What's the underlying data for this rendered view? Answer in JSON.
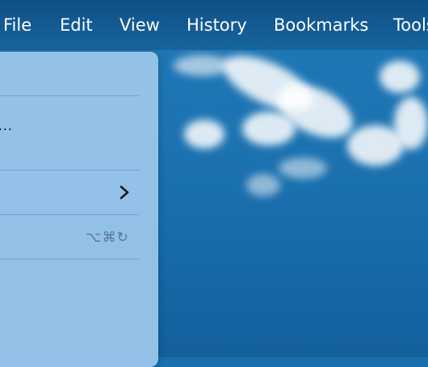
{
  "menubar": {
    "items": [
      {
        "label": "File"
      },
      {
        "label": "Edit"
      },
      {
        "label": "View"
      },
      {
        "label": "History"
      },
      {
        "label": "Bookmarks"
      },
      {
        "label": "Tools"
      }
    ]
  },
  "dropdown": {
    "ellipsis_item": "s…",
    "submenu_indicator": "chevron-right-icon",
    "shortcut_text": "⌥⌘↻"
  },
  "colors": {
    "menubar": "#17659f",
    "dropdown_bg": "#98c4e8",
    "wallpaper": "#1e74b2"
  }
}
